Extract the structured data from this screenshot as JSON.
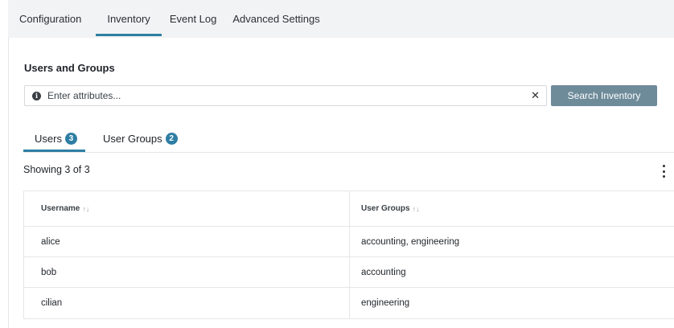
{
  "top_tabs": [
    {
      "label": "Configuration"
    },
    {
      "label": "Inventory"
    },
    {
      "label": "Event Log"
    },
    {
      "label": "Advanced Settings"
    }
  ],
  "active_top_tab": "Inventory",
  "section": {
    "title": "Users and Groups"
  },
  "search": {
    "placeholder": "Enter attributes...",
    "value": "",
    "info_icon": "info-icon",
    "clear_icon": "close-icon",
    "button_label": "Search Inventory"
  },
  "sub_tabs": [
    {
      "label": "Users",
      "count": "3"
    },
    {
      "label": "User Groups",
      "count": "2"
    }
  ],
  "active_sub_tab": "Users",
  "showing_text": "Showing 3 of 3",
  "table": {
    "columns": [
      {
        "label": "Username",
        "sort_glyph": "↑↓"
      },
      {
        "label": "User Groups",
        "sort_glyph": "↑↓"
      }
    ],
    "rows": [
      [
        "alice",
        "accounting, engineering"
      ],
      [
        "bob",
        "accounting"
      ],
      [
        "cilian",
        "engineering"
      ]
    ]
  },
  "colors": {
    "accent": "#2e7ea3",
    "search_button": "#6e8b9a",
    "tab_bar_bg": "#f2f3f4"
  }
}
